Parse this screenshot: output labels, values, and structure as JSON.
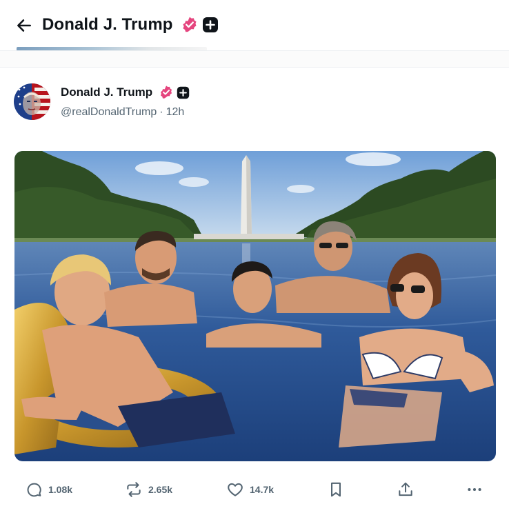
{
  "header": {
    "title": "Donald J. Trump"
  },
  "post": {
    "author_name": "Donald J. Trump",
    "handle": "@realDonaldTrump",
    "separator": "·",
    "time_ago": "12h",
    "image_alt": "Five people relaxing in the Reflecting Pool in front of the Washington Monument"
  },
  "actions": {
    "replies": "1.08k",
    "reposts": "2.65k",
    "likes": "14.7k"
  },
  "icons": {
    "back": "arrow-left-icon",
    "verified": "verified-badge-icon",
    "plus": "plus-badge-icon",
    "reply": "reply-icon",
    "repost": "repost-icon",
    "like": "heart-icon",
    "bookmark": "bookmark-icon",
    "share": "share-icon",
    "more": "more-icon"
  },
  "colors": {
    "verified_badge": "#e5457e",
    "secondary_text": "#536471",
    "primary_text": "#0f1419"
  }
}
